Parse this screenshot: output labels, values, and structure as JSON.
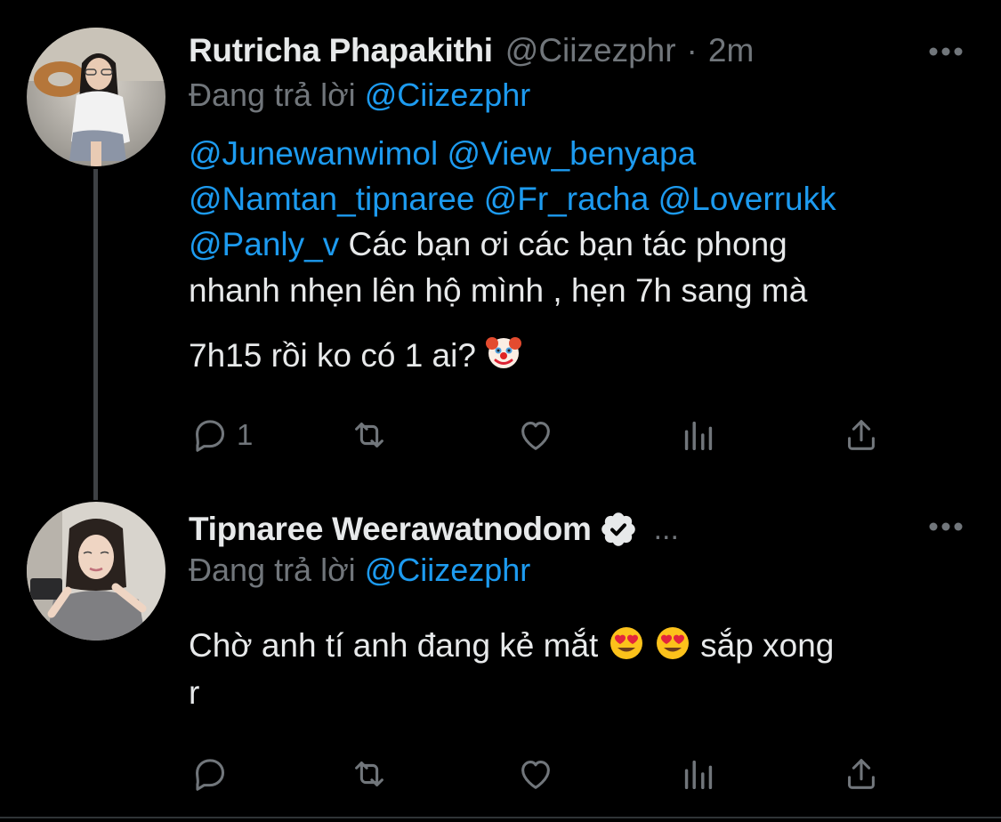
{
  "accent_color": "#1d9bf0",
  "tweets": [
    {
      "display_name": "Rutricha Phapakithi",
      "handle": "@Ciizezphr",
      "separator": "·",
      "time": "2m",
      "replying_prefix": "Đang trả lời",
      "replying_to": "@Ciizezphr",
      "body_lines": [
        [
          "@Junewanwimol",
          " ",
          "@View_benyapa"
        ],
        [
          "@Namtan_tipnaree",
          " ",
          "@Fr_racha",
          " ",
          "@Loverrukk"
        ],
        [
          "@Panly_v",
          " Các bạn ơi các bạn tác phong"
        ],
        [
          "nhanh nhẹn lên hộ mình , hẹn 7h sang mà"
        ],
        [
          "7h15 rồi ko có 1 ai? "
        ]
      ],
      "body_emoji": "clown-face-emoji",
      "actions": {
        "reply_icon": "reply-icon",
        "reply_count": "1",
        "retweet_icon": "retweet-icon",
        "like_icon": "heart-icon",
        "analytics_icon": "analytics-icon",
        "share_icon": "share-icon"
      }
    },
    {
      "display_name": "Tipnaree Weerawatnodom",
      "verified": true,
      "truncation": "...",
      "replying_prefix": "Đang trả lời",
      "replying_to": "@Ciizezphr",
      "body_line1_a": "Chờ anh tí anh đang kẻ mắt ",
      "body_line1_b": "  sắp xong",
      "body_line2": "r",
      "body_emoji": "heart-eyes-emoji",
      "actions": {
        "reply_icon": "reply-icon",
        "reply_count": "",
        "retweet_icon": "retweet-icon",
        "like_icon": "heart-icon",
        "analytics_icon": "analytics-icon",
        "share_icon": "share-icon"
      }
    }
  ]
}
